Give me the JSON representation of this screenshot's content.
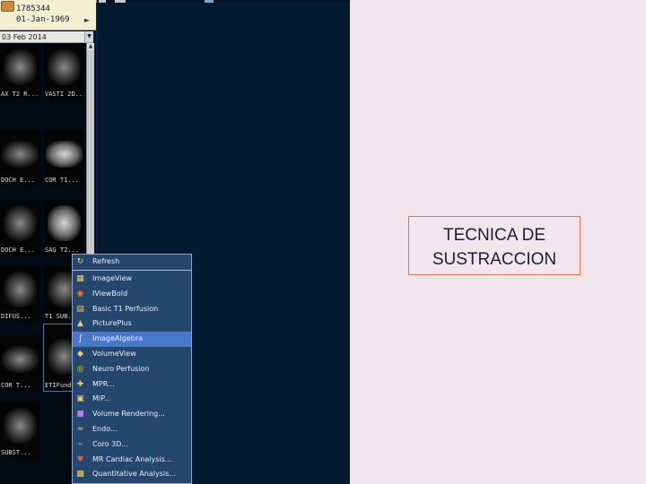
{
  "patient": {
    "id": "1785344",
    "dob": "01-Jan-1969",
    "folder_icon": "folder-icon"
  },
  "study_date": "03 Feb 2014",
  "thumbnails": [
    {
      "caption": "AX T2 R..."
    },
    {
      "caption": "VASTI 2D..."
    },
    {
      "caption": "DOCH E..."
    },
    {
      "caption": "COR T1..."
    },
    {
      "caption": "DOCH E..."
    },
    {
      "caption": "SAG T2..."
    },
    {
      "caption": "DIFUS..."
    },
    {
      "caption": "T1 SUB..."
    },
    {
      "caption": "COR T..."
    },
    {
      "caption": "ETIFund..."
    },
    {
      "caption": "SUBST..."
    }
  ],
  "context_menu": {
    "items": [
      {
        "label": "Refresh",
        "icon": "refresh-icon"
      },
      {
        "label": "ImageView",
        "icon": "image-view-icon"
      },
      {
        "label": "IViewBold",
        "icon": "iview-bold-icon"
      },
      {
        "label": "Basic T1 Perfusion",
        "icon": "perfusion-icon"
      },
      {
        "label": "PicturePlus",
        "icon": "picture-plus-icon"
      },
      {
        "label": "ImageAlgebra",
        "icon": "image-algebra-icon"
      },
      {
        "label": "VolumeView",
        "icon": "volume-view-icon"
      },
      {
        "label": "Neuro Perfusion",
        "icon": "neuro-perfusion-icon"
      },
      {
        "label": "MPR...",
        "icon": "mpr-icon"
      },
      {
        "label": "MIP...",
        "icon": "mip-icon"
      },
      {
        "label": "Volume Rendering...",
        "icon": "volume-rendering-icon"
      },
      {
        "label": "Endo...",
        "icon": "endo-icon"
      },
      {
        "label": "Coro 3D...",
        "icon": "coro-3d-icon"
      },
      {
        "label": "MR Cardiac Analysis...",
        "icon": "cardiac-icon"
      },
      {
        "label": "Quantitative Analysis...",
        "icon": "quantitative-icon"
      }
    ],
    "highlighted": "ImageAlgebra"
  },
  "slide_title": {
    "line1": "TECNICA DE",
    "line2": "SUSTRACCION"
  },
  "colors": {
    "slide_bg": "#f2e5ec",
    "menu_bg": "#25476e",
    "menu_highlight": "#4a78c8",
    "title_border": "#d97a52"
  }
}
